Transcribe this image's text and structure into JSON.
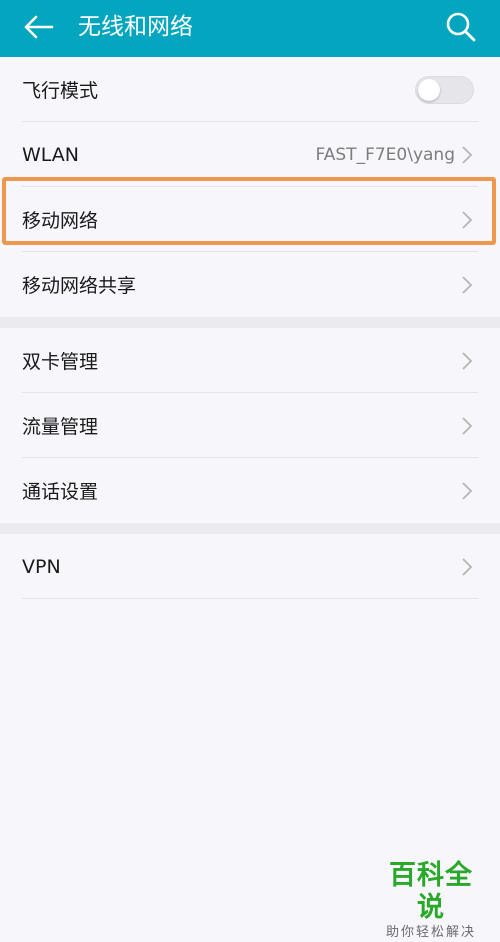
{
  "header": {
    "title": "无线和网络",
    "back_icon": "arrow-left-icon",
    "search_icon": "search-icon",
    "background_color": "#04a6bf"
  },
  "sections": [
    {
      "items": [
        {
          "label": "飞行模式",
          "control": "toggle",
          "on": false
        },
        {
          "label": "WLAN",
          "value": "FAST_F7E0\\yang",
          "control": "chevron"
        },
        {
          "label": "移动网络",
          "control": "chevron",
          "highlighted": true
        },
        {
          "label": "移动网络共享",
          "control": "chevron"
        }
      ]
    },
    {
      "items": [
        {
          "label": "双卡管理",
          "control": "chevron"
        },
        {
          "label": "流量管理",
          "control": "chevron"
        },
        {
          "label": "通话设置",
          "control": "chevron"
        }
      ]
    },
    {
      "items": [
        {
          "label": "VPN",
          "control": "chevron"
        }
      ]
    }
  ],
  "highlight_color": "#f0974e",
  "watermark": {
    "main": "百科全说",
    "sub": "助你轻松解决"
  }
}
